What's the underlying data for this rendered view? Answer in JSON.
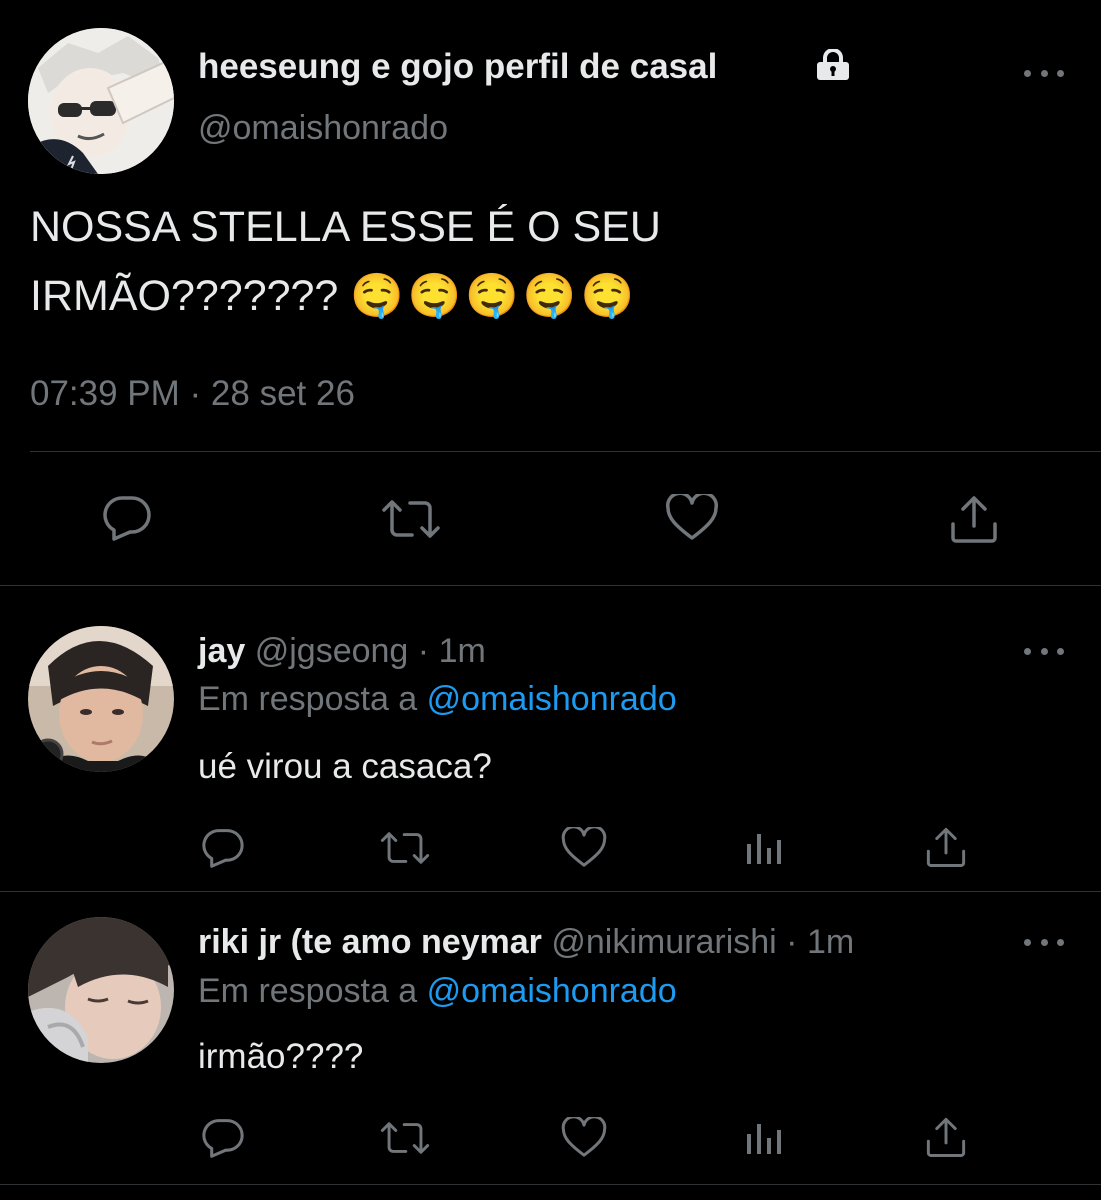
{
  "main_tweet": {
    "display_name": "heeseung e gojo perfil de casal",
    "handle": "@omaishonrado",
    "text_line1": "NOSSA STELLA ESSE É O SEU",
    "text_line2": "IRMÃO???????",
    "emojis": "🤤🤤🤤🤤🤤",
    "timestamp": "07:39 PM · 28 set 26",
    "protected_icon": "lock-icon"
  },
  "replies": [
    {
      "display_name": "jay",
      "handle": "@jgseong",
      "separator": "·",
      "time": "1m",
      "reply_prefix": "Em resposta a",
      "reply_to": "@omaishonrado",
      "text": "ué virou a casaca?"
    },
    {
      "display_name": "riki jr (te amo neymar",
      "handle": "@nikimurarishi",
      "separator": "·",
      "time": "1m",
      "reply_prefix": "Em resposta a",
      "reply_to": "@omaishonrado",
      "text": "irmão????"
    }
  ],
  "colors": {
    "background": "#000000",
    "text": "#e7e9ea",
    "muted": "#71767b",
    "link": "#1d9bf0",
    "divider": "#2f3336"
  }
}
